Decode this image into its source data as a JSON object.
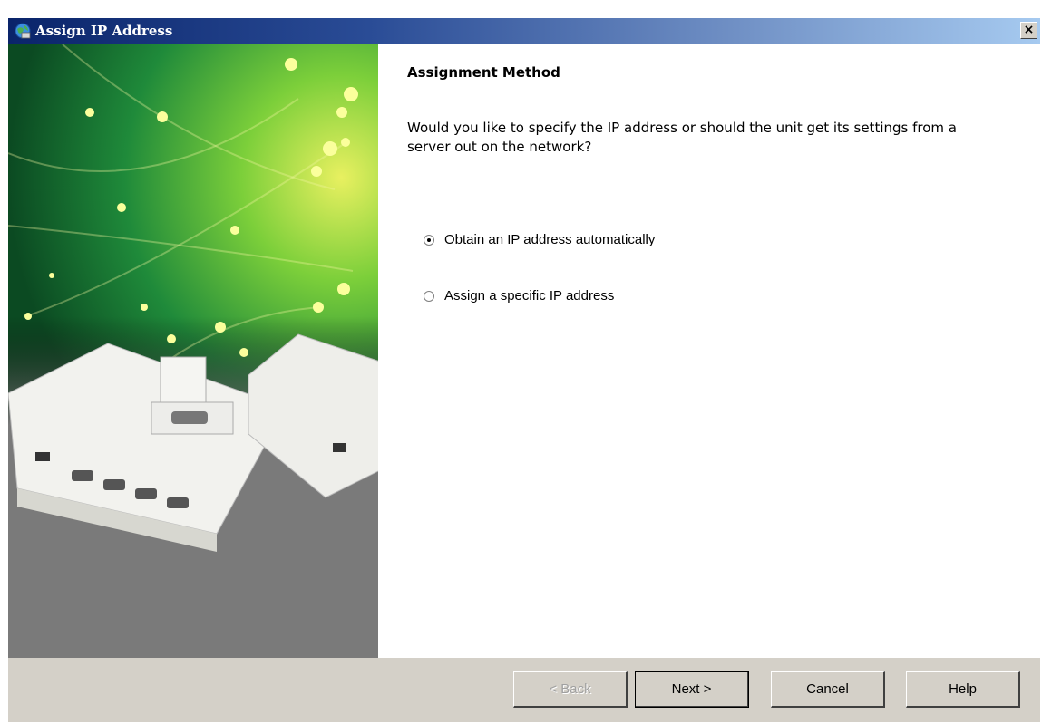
{
  "window": {
    "title": "Assign IP Address",
    "close_label": "×"
  },
  "content": {
    "heading": "Assignment Method",
    "question": "Would you like to specify the IP address or should the unit get its settings from a server out on the network?",
    "options": [
      {
        "label": "Obtain an IP address automatically",
        "selected": true
      },
      {
        "label": "Assign a specific IP address",
        "selected": false
      }
    ]
  },
  "buttons": {
    "back": "< Back",
    "next": "Next >",
    "cancel": "Cancel",
    "help": "Help"
  },
  "icons": {
    "title": "globe-network-icon",
    "close": "close-icon"
  }
}
